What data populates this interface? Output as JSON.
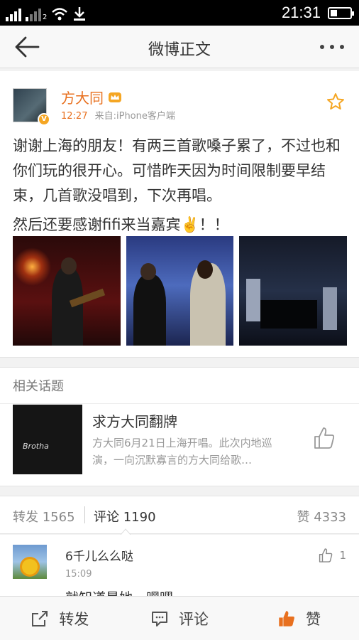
{
  "status_bar": {
    "time": "21:31",
    "network_tag": "2",
    "battery_level": 0.35
  },
  "header": {
    "title": "微博正文"
  },
  "post": {
    "author": "方大同",
    "time": "12:27",
    "source": "来自:iPhone客户端",
    "verified_badge": "V",
    "content_line1": "谢谢上海的朋友！有两三首歌嗓子累了，不过也和你们玩的很开心。可惜昨天因为时间限制要早结束，几首歌没唱到，下次再唱。",
    "content_line2": "然后还要感谢fifi来当嘉宾✌️！！"
  },
  "related": {
    "header": "相关话题",
    "title": "求方大同翻牌",
    "description": "方大同6月21日上海开唱。此次内地巡演，一向沉默寡言的方大同给歌…",
    "thumb_text": "Brotha"
  },
  "tabs": {
    "repost": "转发 1565",
    "comment": "评论 1190",
    "like": "赞 4333"
  },
  "comment": {
    "name": "6千儿么么哒",
    "time": "15:09",
    "text": "就知道是她，嘿嘿",
    "likes": "1"
  },
  "bottom_bar": {
    "repost": "转发",
    "comment": "评论",
    "like": "赞"
  },
  "colors": {
    "accent": "#e8701f",
    "star": "#f5a623"
  }
}
